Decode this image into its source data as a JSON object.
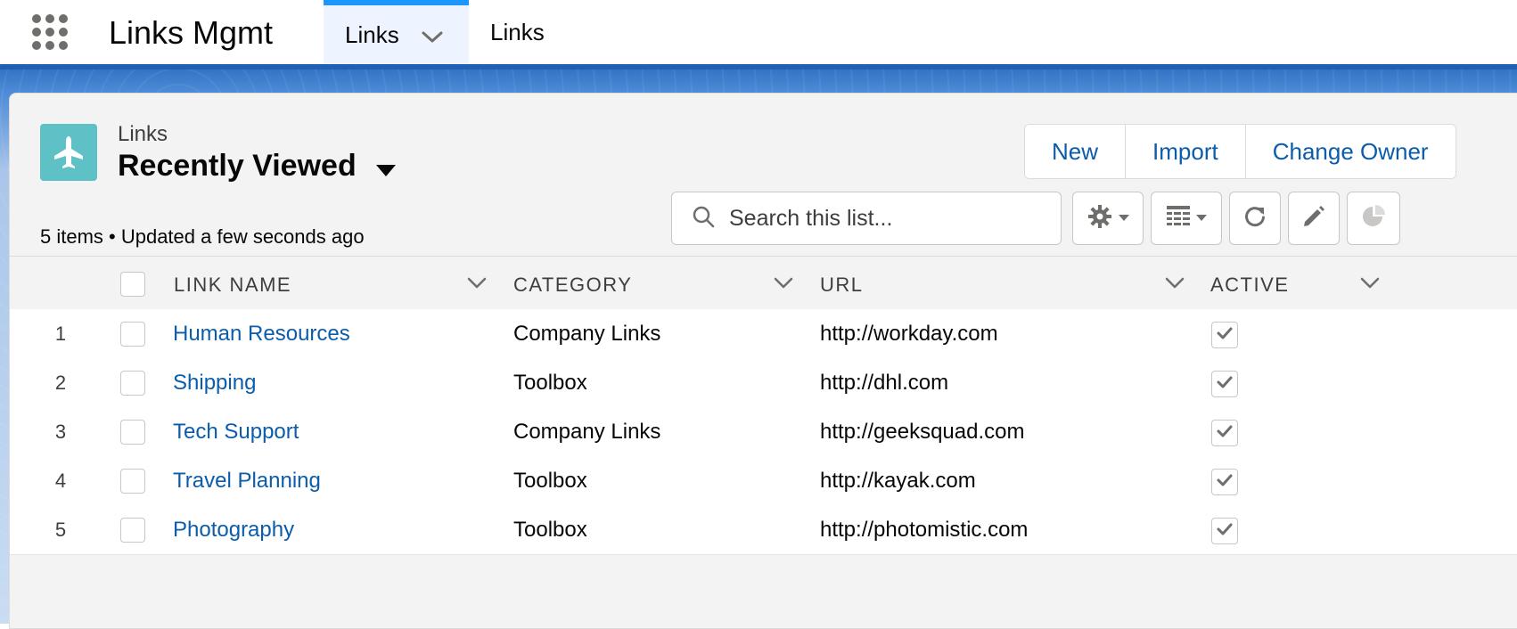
{
  "app": {
    "name": "Links Mgmt"
  },
  "tabs": [
    {
      "label": "Links",
      "active": true
    },
    {
      "label": "Links",
      "active": false
    }
  ],
  "list_header": {
    "object_label": "Links",
    "list_view_name": "Recently Viewed",
    "meta": "5 items • Updated a few seconds ago",
    "icon": "plane-icon",
    "icon_color": "#5ec1c6"
  },
  "actions": {
    "new_label": "New",
    "import_label": "Import",
    "change_owner_label": "Change Owner"
  },
  "search": {
    "placeholder": "Search this list..."
  },
  "toolbar_icons": [
    "gear-icon",
    "table-view-icon",
    "refresh-icon",
    "pencil-icon",
    "pie-chart-icon"
  ],
  "table": {
    "columns": [
      {
        "label": "LINK NAME"
      },
      {
        "label": "CATEGORY"
      },
      {
        "label": "URL"
      },
      {
        "label": "ACTIVE"
      }
    ],
    "rows": [
      {
        "num": "1",
        "name": "Human Resources",
        "category": "Company Links",
        "url": "http://workday.com",
        "active": true
      },
      {
        "num": "2",
        "name": "Shipping",
        "category": "Toolbox",
        "url": "http://dhl.com",
        "active": true
      },
      {
        "num": "3",
        "name": "Tech Support",
        "category": "Company Links",
        "url": "http://geeksquad.com",
        "active": true
      },
      {
        "num": "4",
        "name": "Travel Planning",
        "category": "Toolbox",
        "url": "http://kayak.com",
        "active": true
      },
      {
        "num": "5",
        "name": "Photography",
        "category": "Toolbox",
        "url": "http://photomistic.com",
        "active": true
      }
    ]
  },
  "colors": {
    "link": "#0b5cab",
    "tab_active_border": "#1b96ff",
    "brand_band": "#2c6fc0"
  }
}
